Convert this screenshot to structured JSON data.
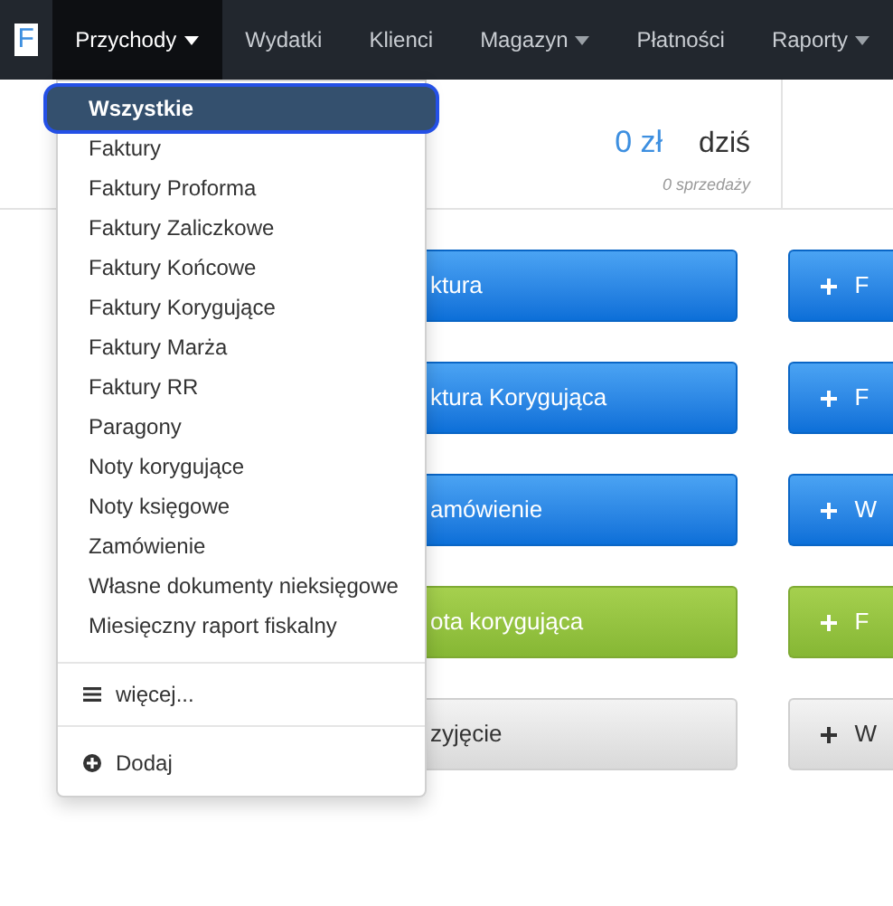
{
  "logo": "F",
  "nav": [
    {
      "label": "Przychody",
      "dropdown": true,
      "selected": true
    },
    {
      "label": "Wydatki",
      "dropdown": false,
      "selected": false
    },
    {
      "label": "Klienci",
      "dropdown": false,
      "selected": false
    },
    {
      "label": "Magazyn",
      "dropdown": true,
      "selected": false
    },
    {
      "label": "Płatności",
      "dropdown": false,
      "selected": false
    },
    {
      "label": "Raporty",
      "dropdown": true,
      "selected": false
    }
  ],
  "stats": {
    "amount": "0 zł",
    "period": "dziś",
    "count": "0 sprzedaży"
  },
  "buttons": [
    {
      "label": "ktura",
      "side_label": "F",
      "kind": "primary"
    },
    {
      "label": "ktura Korygująca",
      "side_label": "F",
      "kind": "primary"
    },
    {
      "label": "amówienie",
      "side_label": "W",
      "kind": "primary"
    },
    {
      "label": "ota korygująca",
      "side_label": "F",
      "kind": "success"
    },
    {
      "label": "zyjęcie",
      "side_label": "W",
      "kind": "default"
    }
  ],
  "menu": {
    "items": [
      {
        "label": "Wszystkie",
        "selected": true
      },
      {
        "label": "Faktury",
        "selected": false
      },
      {
        "label": "Faktury Proforma",
        "selected": false
      },
      {
        "label": "Faktury Zaliczkowe",
        "selected": false
      },
      {
        "label": "Faktury Końcowe",
        "selected": false
      },
      {
        "label": "Faktury Korygujące",
        "selected": false
      },
      {
        "label": "Faktury Marża",
        "selected": false
      },
      {
        "label": "Faktury RR",
        "selected": false
      },
      {
        "label": "Paragony",
        "selected": false
      },
      {
        "label": "Noty korygujące",
        "selected": false
      },
      {
        "label": "Noty księgowe",
        "selected": false
      },
      {
        "label": "Zamówienie",
        "selected": false
      },
      {
        "label": "Własne dokumenty nieksięgowe",
        "selected": false
      },
      {
        "label": "Miesięczny raport fiskalny",
        "selected": false
      }
    ],
    "more": "więcej...",
    "add": "Dodaj"
  }
}
